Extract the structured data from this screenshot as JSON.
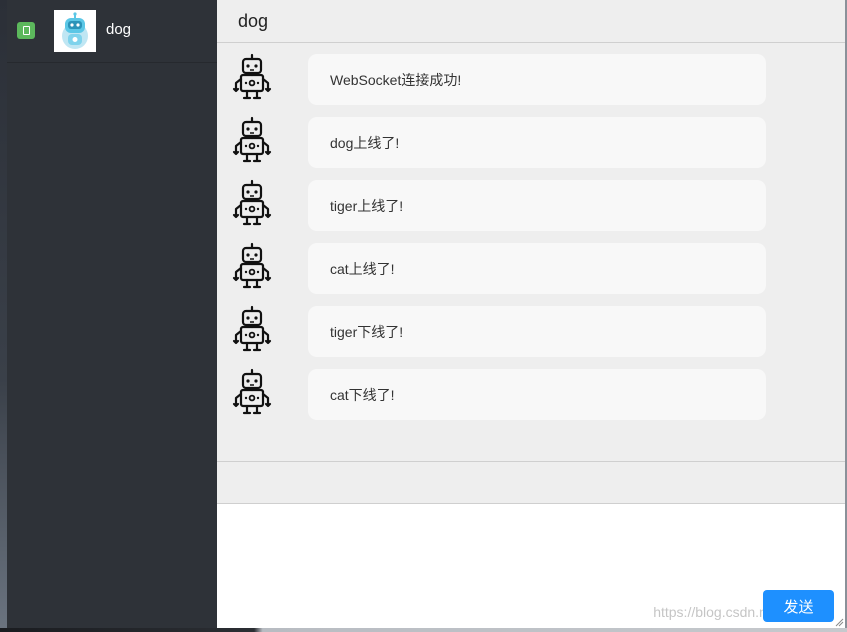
{
  "sidebar": {
    "contacts": [
      {
        "name": "dog",
        "status": "online",
        "avatar_icon": "robot-avatar-icon"
      }
    ]
  },
  "chat": {
    "title": "dog",
    "messages": [
      {
        "text": "WebSocket连接成功!"
      },
      {
        "text": "dog上线了!"
      },
      {
        "text": "tiger上线了!"
      },
      {
        "text": "cat上线了!"
      },
      {
        "text": "tiger下线了!"
      },
      {
        "text": "cat下线了!"
      }
    ]
  },
  "input": {
    "value": "",
    "send_label": "发送"
  },
  "watermark": "https://blog.csdn.net/N_Peng",
  "colors": {
    "sidebar_bg": "#2e3238",
    "online_badge": "#5cb85c",
    "send_button": "#1e90ff",
    "bubble_bg": "#f8f8f8"
  }
}
